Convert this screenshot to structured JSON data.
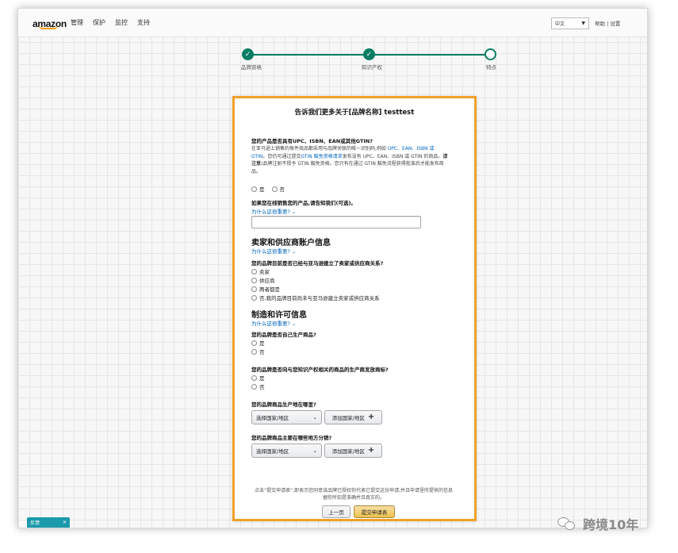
{
  "topbar": {
    "logo": "amazon",
    "nav": [
      "管理",
      "保护",
      "监控",
      "支持"
    ],
    "language": "中文",
    "help": "帮助",
    "settings": "设置",
    "separator": "|"
  },
  "progress": {
    "steps": [
      {
        "label": "品牌资格",
        "status": "done"
      },
      {
        "label": "知识产权",
        "status": "done"
      },
      {
        "label": "特点",
        "status": "current"
      }
    ]
  },
  "panel": {
    "title": "告诉我们更多关于[品牌名称] testtest",
    "q_upc": "您的产品是否具有UPC、ISBN、EAN或其他GTIN?",
    "desc_upc_1": "在亚马逊上销售的每件商品都采用与品牌关联的唯一识别码,例如 ",
    "desc_upc_links": "UPC、EAN、ISBN 或 GTIN",
    "desc_upc_2": "。您仍可通过提交",
    "desc_upc_link2": "GTIN 豁免资格请求",
    "desc_upc_3": "发布没有 UPC、EAN、ISBN 或 GTIN 的商品。",
    "desc_upc_note_label": "请注意:",
    "desc_upc_4": "品牌注册不授予 GTIN 豁免资格。您只有在通过 GTIN 豁免流程获得批准后才能发布商品。",
    "yes": "是",
    "no": "否",
    "q_sell": "如果您在线销售您的产品,请告知我们(可选)。",
    "why_important": "为什么这很重要?",
    "section_seller": "卖家和供应商账户信息",
    "why_seller": "为什么这很重要?",
    "q_relation": "您的品牌目前是否已经与亚马逊建立了卖家或供应商关系?",
    "relation_options": [
      "卖家",
      "供应商",
      "两者都是",
      "否,我的品牌目前尚未与亚马逊建立卖家或供应商关系"
    ],
    "section_mfg": "制造和许可信息",
    "why_mfg": "为什么这很重要?",
    "q_manufacture": "您的品牌是否自己生产商品?",
    "q_license": "您的品牌是否向与您知识产权相关的商品的生产商发放商标?",
    "q_where_made": "您的品牌商品生产地在哪里?",
    "q_where_sold": "您的品牌商品主要在哪些地方分销?",
    "select_country": "选择国家/地区",
    "add_country": "添加国家/地区",
    "footnote": "点击“提交申请表”,即表示您同意该品牌已授权你代表它提交这份申请,并且申请里所提供的信息据你所知是准确并且真实的。",
    "back_button": "上一页",
    "submit_button": "提交申请表"
  },
  "bottom_tab": {
    "label": "反馈",
    "close": "✕"
  },
  "watermark": {
    "text": "跨境10年"
  }
}
